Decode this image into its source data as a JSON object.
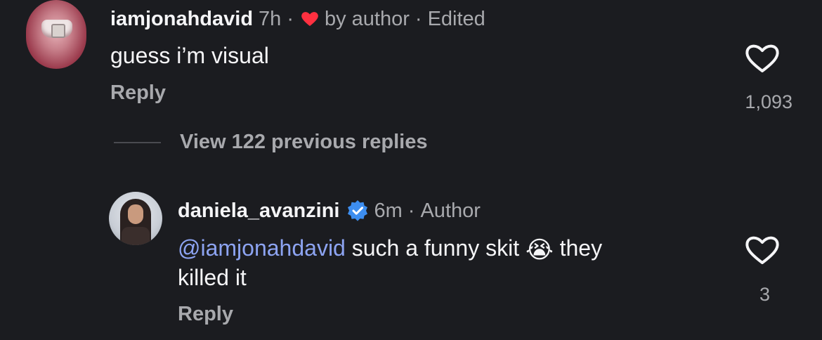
{
  "comments": [
    {
      "username": "iamjonahdavid",
      "time": "7h",
      "sep1": "·",
      "liked_by": "by author",
      "sep2": "·",
      "edited": "Edited",
      "text": "guess i’m visual",
      "reply_label": "Reply",
      "like_count": "1,093"
    },
    {
      "username": "daniela_avanzini",
      "verified": true,
      "time": "6m",
      "sep1": "·",
      "role": "Author",
      "mention": "@iamjonahdavid",
      "text_before_emoji": " such a funny skit ",
      "text_after_emoji": " they",
      "text_line2": "killed it",
      "emoji": "😭",
      "reply_label": "Reply",
      "like_count": "3"
    }
  ],
  "thread": {
    "view_replies_label": "View 122 previous replies"
  },
  "colors": {
    "background": "#1b1c20",
    "text": "#f5f5f7",
    "muted": "#a8a9ad",
    "mention": "#8da4f2",
    "heart_red": "#ff3040",
    "verified_blue": "#3d8ef0"
  },
  "icons": {
    "like": "heart-outline-icon",
    "liked_by_author": "heart-filled-icon",
    "verified": "verified-badge-icon"
  }
}
